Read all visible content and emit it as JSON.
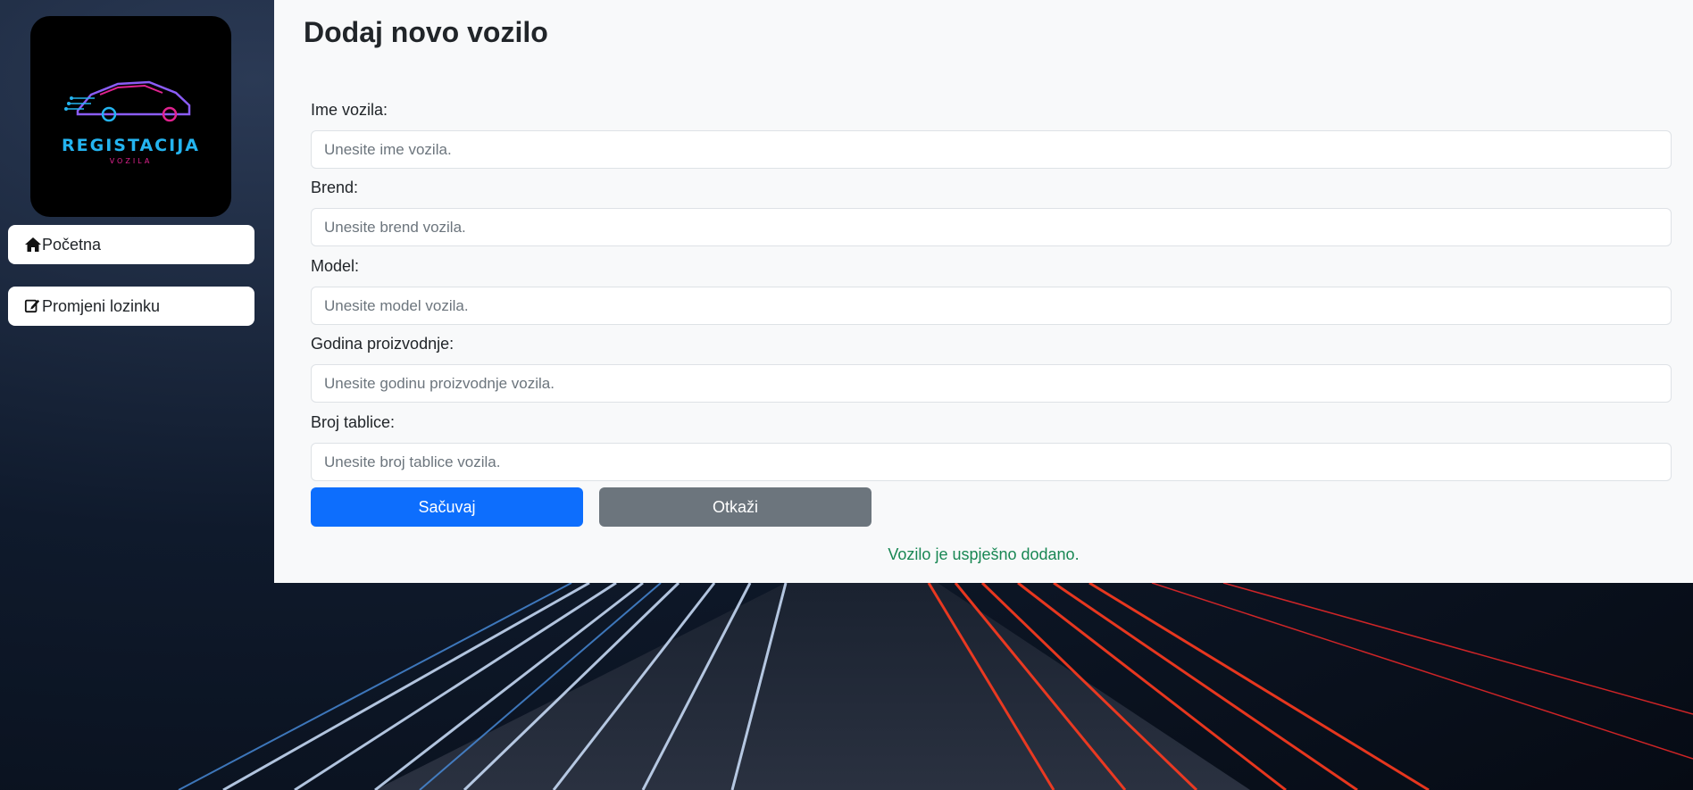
{
  "colors": {
    "primary": "#0d6efd",
    "secondary": "#6c757d",
    "success": "#198754",
    "logo_blue": "#24b4f0",
    "logo_pink": "#e0228f"
  },
  "logo": {
    "title": "REGISTACIJA",
    "subtitle": "VOZILA"
  },
  "sidebar": {
    "items": [
      {
        "label": "Početna",
        "icon": "home-icon"
      },
      {
        "label": "Promjeni lozinku",
        "icon": "edit-icon"
      }
    ]
  },
  "form": {
    "title": "Dodaj novo vozilo",
    "fields": [
      {
        "label": "Ime vozila:",
        "placeholder": "Unesite ime vozila.",
        "value": ""
      },
      {
        "label": "Brend:",
        "placeholder": "Unesite brend vozila.",
        "value": ""
      },
      {
        "label": "Model:",
        "placeholder": "Unesite model vozila.",
        "value": ""
      },
      {
        "label": "Godina proizvodnje:",
        "placeholder": "Unesite godinu proizvodnje vozila.",
        "value": ""
      },
      {
        "label": "Broj tablice:",
        "placeholder": "Unesite broj tablice vozila.",
        "value": ""
      }
    ],
    "save_label": "Sačuvaj",
    "cancel_label": "Otkaži",
    "success_message": "Vozilo je uspješno dodano."
  }
}
